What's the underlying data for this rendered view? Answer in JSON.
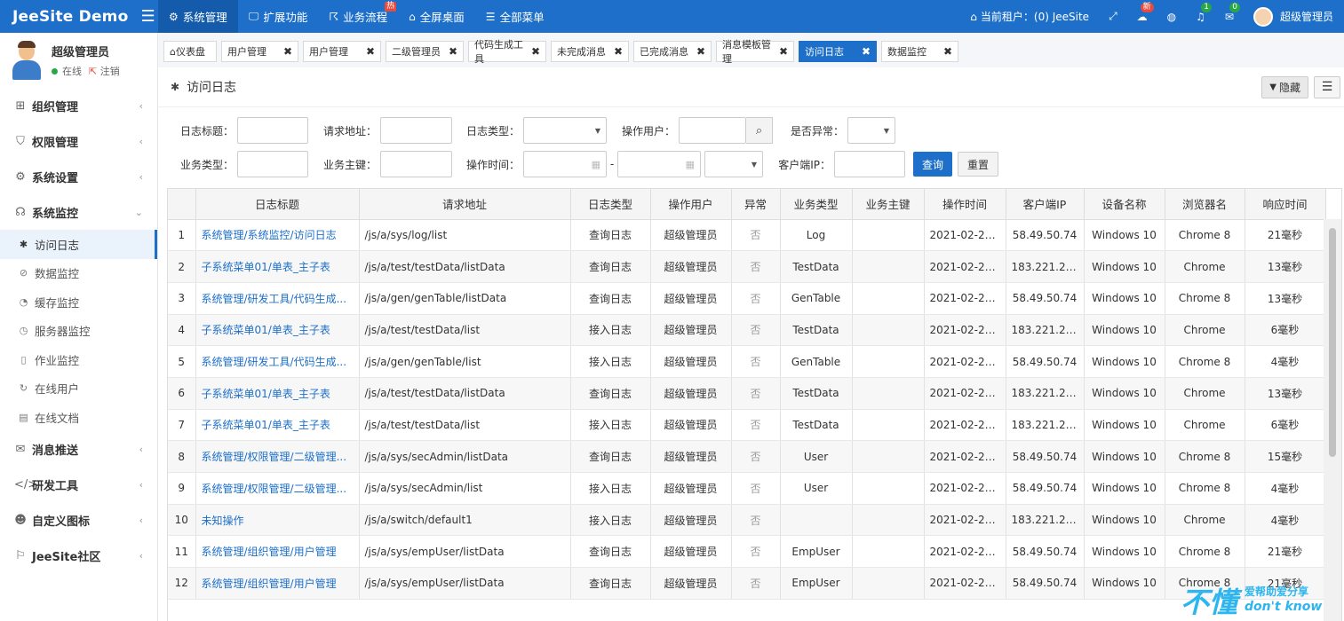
{
  "brand": {
    "name": "JeeSite Demo"
  },
  "topnav": [
    {
      "label": "系统管理",
      "icon": "gear-icon",
      "glyph": "⚙",
      "active": true
    },
    {
      "label": "扩展功能",
      "icon": "monitor-icon",
      "glyph": "🖵",
      "active": false
    },
    {
      "label": "业务流程",
      "icon": "flow-icon",
      "glyph": "☈",
      "active": false,
      "badge": "热"
    },
    {
      "label": "全屏桌面",
      "icon": "home-icon",
      "glyph": "⌂",
      "active": false
    },
    {
      "label": "全部菜单",
      "icon": "list-icon",
      "glyph": "☰",
      "active": false
    }
  ],
  "topright": {
    "tenant_label": "当前租户：(0) JeeSite",
    "new_badge": "新",
    "notify_count": "1",
    "mail_count": "0",
    "username": "超级管理员"
  },
  "user_panel": {
    "name": "超级管理员",
    "status": "在线",
    "logout": "注销"
  },
  "sidebar": {
    "groups_top": [
      {
        "label": "组织管理",
        "icon": "grid-icon",
        "glyph": "⊞"
      },
      {
        "label": "权限管理",
        "icon": "shield-icon",
        "glyph": "⛉"
      },
      {
        "label": "系统设置",
        "icon": "gear-icon",
        "glyph": "⚙"
      }
    ],
    "monitor_group": {
      "label": "系统监控",
      "icon": "bug-icon",
      "glyph": "☊"
    },
    "monitor_items": [
      {
        "label": "访问日志",
        "icon": "bug-icon",
        "glyph": "✱",
        "active": true
      },
      {
        "label": "数据监控",
        "icon": "ban-icon",
        "glyph": "⊘",
        "active": false
      },
      {
        "label": "缓存监控",
        "icon": "dashboard-icon",
        "glyph": "◔",
        "active": false
      },
      {
        "label": "服务器监控",
        "icon": "speedometer-icon",
        "glyph": "◷",
        "active": false
      },
      {
        "label": "作业监控",
        "icon": "phone-icon",
        "glyph": "▯",
        "active": false
      },
      {
        "label": "在线用户",
        "icon": "refresh-icon",
        "glyph": "↻",
        "active": false
      },
      {
        "label": "在线文档",
        "icon": "book-icon",
        "glyph": "▤",
        "active": false
      }
    ],
    "groups_bottom": [
      {
        "label": "消息推送",
        "icon": "message-icon",
        "glyph": "✉"
      },
      {
        "label": "研发工具",
        "icon": "code-icon",
        "glyph": "</>"
      },
      {
        "label": "自定义图标",
        "icon": "custom-icon",
        "glyph": "☻"
      },
      {
        "label": "JeeSite社区",
        "icon": "community-icon",
        "glyph": "⚐"
      }
    ]
  },
  "tabs": [
    {
      "label": "仪表盘",
      "home": true,
      "active": false
    },
    {
      "label": "用户管理",
      "active": false
    },
    {
      "label": "用户管理",
      "active": false
    },
    {
      "label": "二级管理员",
      "active": false
    },
    {
      "label": "代码生成工具",
      "active": false
    },
    {
      "label": "未完成消息",
      "active": false
    },
    {
      "label": "已完成消息",
      "active": false
    },
    {
      "label": "消息模板管理",
      "active": false
    },
    {
      "label": "访问日志",
      "active": true
    },
    {
      "label": "数据监控",
      "active": false
    }
  ],
  "page": {
    "title": "访问日志",
    "hide_label": "隐藏"
  },
  "filters": {
    "log_title": "日志标题：",
    "request_url": "请求地址：",
    "log_type": "日志类型：",
    "operator": "操作用户：",
    "is_exception": "是否异常：",
    "biz_type": "业务类型：",
    "biz_key": "业务主键：",
    "op_time": "操作时间：",
    "date_sep": "-",
    "client_ip": "客户端IP：",
    "query_btn": "查询",
    "reset_btn": "重置"
  },
  "table": {
    "columns": [
      "",
      "日志标题",
      "请求地址",
      "日志类型",
      "操作用户",
      "异常",
      "业务类型",
      "业务主键",
      "操作时间",
      "客户端IP",
      "设备名称",
      "浏览器名",
      "响应时间"
    ],
    "rows": [
      [
        "1",
        "系统管理/系统监控/访问日志",
        "/js/a/sys/log/list",
        "查询日志",
        "超级管理员",
        "否",
        "Log",
        "",
        "2021-02-23 ...",
        "58.49.50.74",
        "Windows 10",
        "Chrome 8",
        "21毫秒"
      ],
      [
        "2",
        "子系统菜单01/单表_主子表",
        "/js/a/test/testData/listData",
        "查询日志",
        "超级管理员",
        "否",
        "TestData",
        "",
        "2021-02-23 ...",
        "183.221.21.70",
        "Windows 10",
        "Chrome",
        "13毫秒"
      ],
      [
        "3",
        "系统管理/研发工具/代码生成...",
        "/js/a/gen/genTable/listData",
        "查询日志",
        "超级管理员",
        "否",
        "GenTable",
        "",
        "2021-02-23 ...",
        "58.49.50.74",
        "Windows 10",
        "Chrome 8",
        "13毫秒"
      ],
      [
        "4",
        "子系统菜单01/单表_主子表",
        "/js/a/test/testData/list",
        "接入日志",
        "超级管理员",
        "否",
        "TestData",
        "",
        "2021-02-23 ...",
        "183.221.21.70",
        "Windows 10",
        "Chrome",
        "6毫秒"
      ],
      [
        "5",
        "系统管理/研发工具/代码生成...",
        "/js/a/gen/genTable/list",
        "接入日志",
        "超级管理员",
        "否",
        "GenTable",
        "",
        "2021-02-23 ...",
        "58.49.50.74",
        "Windows 10",
        "Chrome 8",
        "4毫秒"
      ],
      [
        "6",
        "子系统菜单01/单表_主子表",
        "/js/a/test/testData/listData",
        "查询日志",
        "超级管理员",
        "否",
        "TestData",
        "",
        "2021-02-23 ...",
        "183.221.21.70",
        "Windows 10",
        "Chrome",
        "13毫秒"
      ],
      [
        "7",
        "子系统菜单01/单表_主子表",
        "/js/a/test/testData/list",
        "接入日志",
        "超级管理员",
        "否",
        "TestData",
        "",
        "2021-02-23 ...",
        "183.221.21.70",
        "Windows 10",
        "Chrome",
        "6毫秒"
      ],
      [
        "8",
        "系统管理/权限管理/二级管理...",
        "/js/a/sys/secAdmin/listData",
        "查询日志",
        "超级管理员",
        "否",
        "User",
        "",
        "2021-02-23 ...",
        "58.49.50.74",
        "Windows 10",
        "Chrome 8",
        "15毫秒"
      ],
      [
        "9",
        "系统管理/权限管理/二级管理...",
        "/js/a/sys/secAdmin/list",
        "接入日志",
        "超级管理员",
        "否",
        "User",
        "",
        "2021-02-23 ...",
        "58.49.50.74",
        "Windows 10",
        "Chrome 8",
        "4毫秒"
      ],
      [
        "10",
        "未知操作",
        "/js/a/switch/default1",
        "接入日志",
        "超级管理员",
        "否",
        "",
        "",
        "2021-02-23 ...",
        "183.221.21.70",
        "Windows 10",
        "Chrome",
        "4毫秒"
      ],
      [
        "11",
        "系统管理/组织管理/用户管理",
        "/js/a/sys/empUser/listData",
        "查询日志",
        "超级管理员",
        "否",
        "EmpUser",
        "",
        "2021-02-23 ...",
        "58.49.50.74",
        "Windows 10",
        "Chrome 8",
        "21毫秒"
      ],
      [
        "12",
        "系统管理/组织管理/用户管理",
        "/js/a/sys/empUser/listData",
        "查询日志",
        "超级管理员",
        "否",
        "EmpUser",
        "",
        "2021-02-23 ...",
        "58.49.50.74",
        "Windows 10",
        "Chrome 8",
        "21毫秒"
      ]
    ]
  },
  "watermark": {
    "big": "不懂",
    "top": "爱帮助爱分享",
    "bottom": "don't know"
  }
}
